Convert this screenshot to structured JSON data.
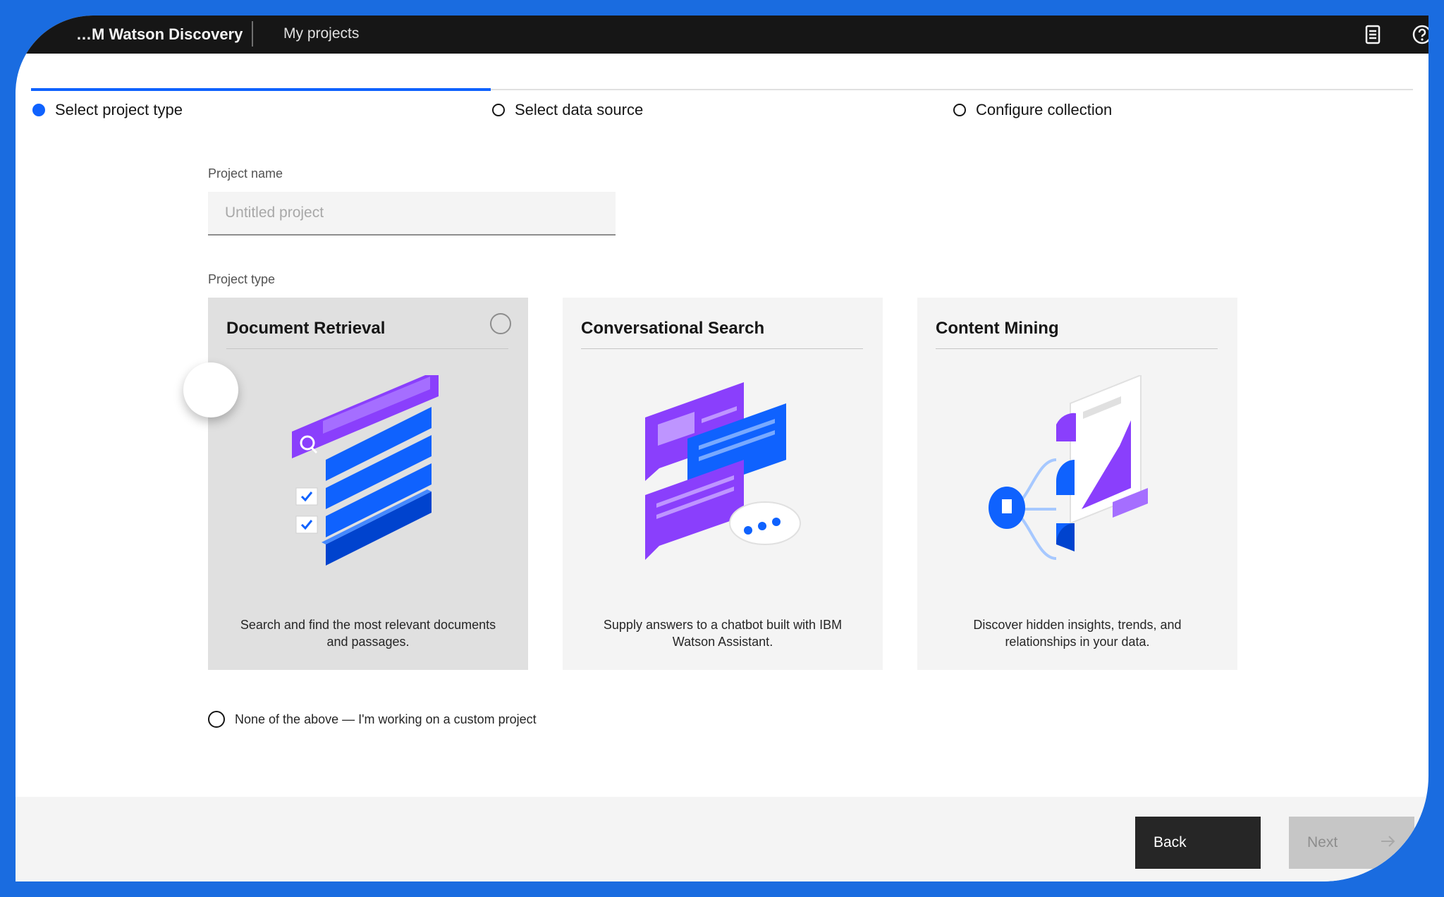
{
  "header": {
    "brand": "…M Watson Discovery",
    "nav_label": "My projects",
    "icons": [
      "notes-icon",
      "help-icon"
    ]
  },
  "progress": {
    "steps": [
      {
        "label": "Select project type",
        "state": "current"
      },
      {
        "label": "Select data source",
        "state": "incomplete"
      },
      {
        "label": "Configure collection",
        "state": "incomplete"
      }
    ]
  },
  "form": {
    "project_name_label": "Project name",
    "project_name_placeholder": "Untitled project",
    "project_name_value": "",
    "project_type_label": "Project type",
    "cards": [
      {
        "title": "Document Retrieval",
        "description": "Search and find the most relevant documents and passages.",
        "icon": "document-retrieval-illustration",
        "selected": false
      },
      {
        "title": "Conversational Search",
        "description": "Supply answers to a chatbot built with IBM Watson Assistant.",
        "icon": "conversational-search-illustration",
        "selected": false
      },
      {
        "title": "Content Mining",
        "description": "Discover hidden insights, trends, and relationships in your data.",
        "icon": "content-mining-illustration",
        "selected": false
      }
    ],
    "custom_option_label": "None of the above — I'm working on a custom project"
  },
  "footer": {
    "back_label": "Back",
    "next_label": "Next",
    "next_icon": "arrow-right-icon"
  },
  "colors": {
    "accent": "#0f62fe",
    "frame": "#1a6ce0",
    "topbar": "#161616",
    "purple": "#8a3ffc",
    "blue": "#0f62fe"
  }
}
